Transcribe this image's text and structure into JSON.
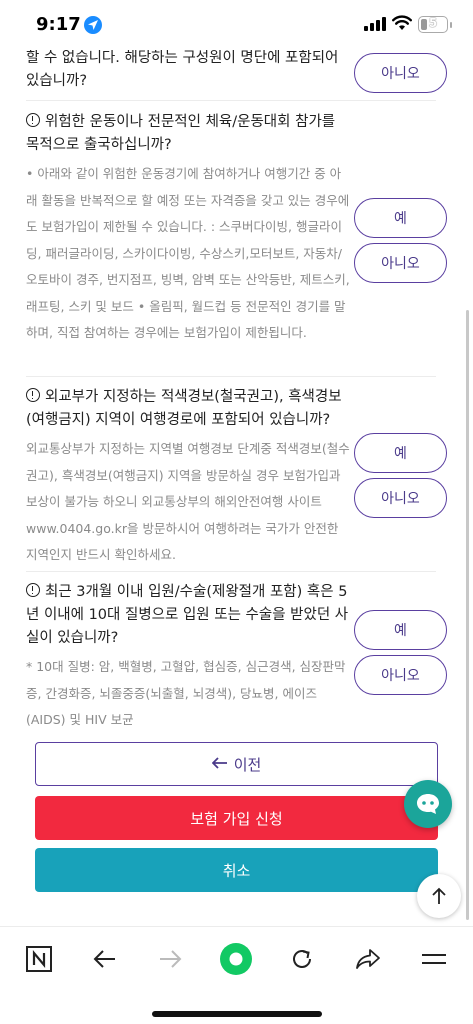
{
  "status_bar": {
    "time": "9:17",
    "battery_level": "5"
  },
  "questions": [
    {
      "title_partial": "할 수 없습니다. 해당하는 구성원이 명단에 포함되어 있습니까?",
      "no_label": "아니오"
    },
    {
      "title": "위험한 운동이나 전문적인 체육/운동대회 참가를 목적으로 출국하십니까?",
      "description": "• 아래와 같이 위험한 운동경기에 참여하거나 여행기간 중 아래 활동을 반복적으로 할 예정 또는 자격증을 갖고 있는 경우에도 보험가입이 제한될 수 있습니다. : 스쿠버다이빙, 행글라이딩, 패러글라이딩, 스카이다이빙, 수상스키,모터보트, 자동차/오토바이 경주, 번지점프, 빙벽, 암벽 또는 산악등반, 제트스키,래프팅, 스키 및 보드 • 올림픽, 월드컵 등 전문적인 경기를 말하며, 직접 참여하는 경우에는 보험가입이 제한됩니다.",
      "yes_label": "예",
      "no_label": "아니오"
    },
    {
      "title": "외교부가 지정하는 적색경보(철국권고), 흑색경보(여행금지) 지역이 여행경로에 포함되어 있습니까?",
      "description": "외교통상부가 지정하는 지역별 여행경보 단계중 적색경보(철수권고), 흑색경보(여행금지) 지역을 방문하실 경우 보험가입과 보상이 불가능 하오니 외교통상부의 해외안전여행 사이트 www.0404.go.kr을 방문하시어 여행하려는 국가가 안전한 지역인지 반드시 확인하세요.",
      "yes_label": "예",
      "no_label": "아니오"
    },
    {
      "title": "최근 3개월 이내 입원/수술(제왕절개 포함) 혹은 5년 이내에 10대 질병으로 입원 또는 수술을 받았던 사실이 있습니까?",
      "description": "* 10대 질병: 암, 백혈병, 고혈압, 협심증, 심근경색, 심장판막증, 간경화증, 뇌졸중증(뇌출혈, 뇌경색), 당뇨병, 에이즈(AIDS) 및 HIV 보균",
      "yes_label": "예",
      "no_label": "아니오"
    }
  ],
  "actions": {
    "prev_label": "이전",
    "apply_label": "보험 가입 신청",
    "cancel_label": "취소"
  },
  "colors": {
    "accent_purple": "#5a3fa0",
    "apply_red": "#f2293f",
    "cancel_teal": "#18a2ba",
    "chat_teal": "#1ba59a",
    "browser_green": "#12c964"
  },
  "icons": {
    "status": [
      "location-arrow-icon",
      "signal-icon",
      "wifi-icon",
      "battery-icon"
    ],
    "floating": [
      "chat-bubble-icon",
      "arrow-up-icon"
    ],
    "bottom_bar": [
      "naver-n-icon",
      "back-arrow-icon",
      "forward-arrow-icon",
      "green-home-icon",
      "reload-icon",
      "share-icon",
      "menu-icon"
    ]
  }
}
